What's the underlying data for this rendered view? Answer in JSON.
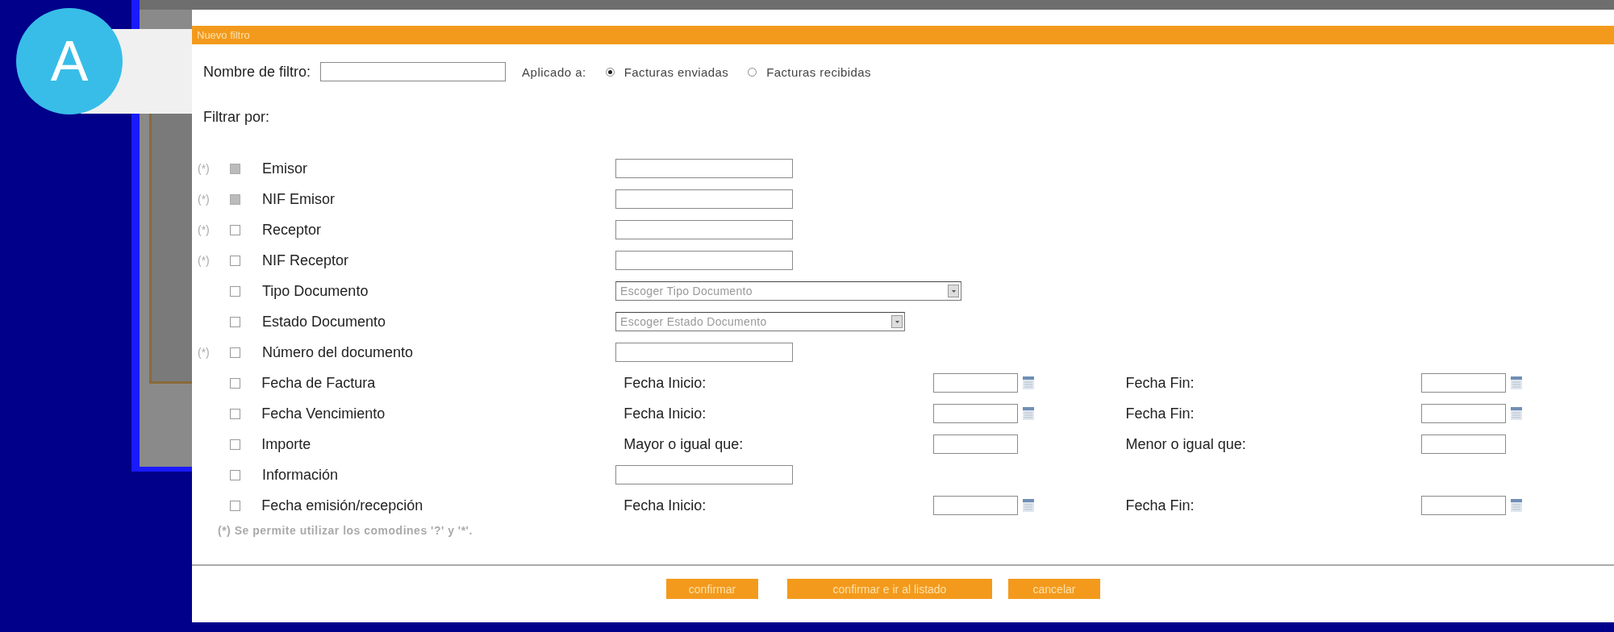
{
  "badge": "A",
  "dialog": {
    "title": "Nuevo filtro",
    "filter_name": {
      "label": "Nombre de filtro:"
    },
    "applied_to": {
      "label": "Aplicado a:",
      "options": [
        {
          "label": "Facturas enviadas",
          "selected": true
        },
        {
          "label": "Facturas recibidas",
          "selected": false
        }
      ]
    },
    "filter_by": "Filtrar por:",
    "criteria": [
      {
        "kind": "text",
        "note": "(*)",
        "label": "Emisor",
        "checked": false,
        "disabled": true
      },
      {
        "kind": "text",
        "note": "(*)",
        "label": "NIF Emisor",
        "checked": false,
        "disabled": true
      },
      {
        "kind": "text",
        "note": "(*)",
        "label": "Receptor",
        "checked": false,
        "disabled": false
      },
      {
        "kind": "text",
        "note": "(*)",
        "label": "NIF Receptor",
        "checked": false,
        "disabled": false
      },
      {
        "kind": "select",
        "label": "Tipo Documento",
        "checked": false,
        "disabled": false,
        "placeholder": "Escoger Tipo Documento"
      },
      {
        "kind": "select",
        "label": "Estado Documento",
        "checked": false,
        "disabled": false,
        "placeholder": "Escoger Estado Documento"
      },
      {
        "kind": "text",
        "note": "(*)",
        "label": "Número del documento",
        "checked": false,
        "disabled": false
      },
      {
        "kind": "range",
        "label": "Fecha de Factura",
        "checked": false,
        "disabled": false,
        "from_label": "Fecha Inicio:",
        "to_label": "Fecha Fin:",
        "calendar": true
      },
      {
        "kind": "range",
        "label": "Fecha Vencimiento",
        "checked": false,
        "disabled": false,
        "from_label": "Fecha Inicio:",
        "to_label": "Fecha Fin:",
        "calendar": true
      },
      {
        "kind": "range",
        "label": "Importe",
        "checked": false,
        "disabled": false,
        "from_label": "Mayor o igual que:",
        "to_label": "Menor o igual que:",
        "calendar": false
      },
      {
        "kind": "text",
        "label": "Información",
        "checked": false,
        "disabled": false
      },
      {
        "kind": "range",
        "label": "Fecha emisión/recepción",
        "checked": false,
        "disabled": false,
        "from_label": "Fecha Inicio:",
        "to_label": "Fecha Fin:",
        "calendar": true
      }
    ],
    "footnote": "(*) Se permite utilizar los comodines '?' y '*'.",
    "buttons": [
      "confirmar",
      "confirmar e ir al listado",
      "cancelar"
    ]
  }
}
